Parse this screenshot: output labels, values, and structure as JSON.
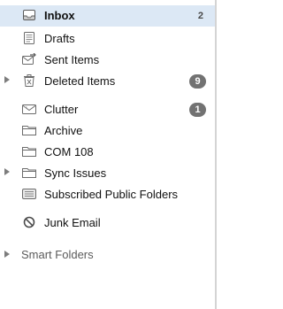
{
  "folders": [
    {
      "label": "Inbox",
      "icon": "inbox-icon",
      "count": "2",
      "selected": true
    },
    {
      "label": "Drafts",
      "icon": "drafts-icon"
    },
    {
      "label": "Sent Items",
      "icon": "sent-items-icon"
    },
    {
      "label": "Deleted Items",
      "icon": "trash-icon",
      "badge": "9"
    },
    {
      "label": "Clutter",
      "icon": "clutter-icon",
      "badge": "1"
    },
    {
      "label": "Archive",
      "icon": "folder-icon"
    },
    {
      "label": "COM 108",
      "icon": "folder-icon"
    },
    {
      "label": "Sync Issues",
      "icon": "folder-icon"
    },
    {
      "label": "Subscribed Public Folders",
      "icon": "public-folders-icon"
    },
    {
      "label": "Junk Email",
      "icon": "junk-icon"
    }
  ],
  "groups": [
    {
      "label": "Smart Folders"
    }
  ],
  "colors": {
    "selection": "#dce8f5",
    "badge": "#727272",
    "icon": "#6b6b6b"
  }
}
